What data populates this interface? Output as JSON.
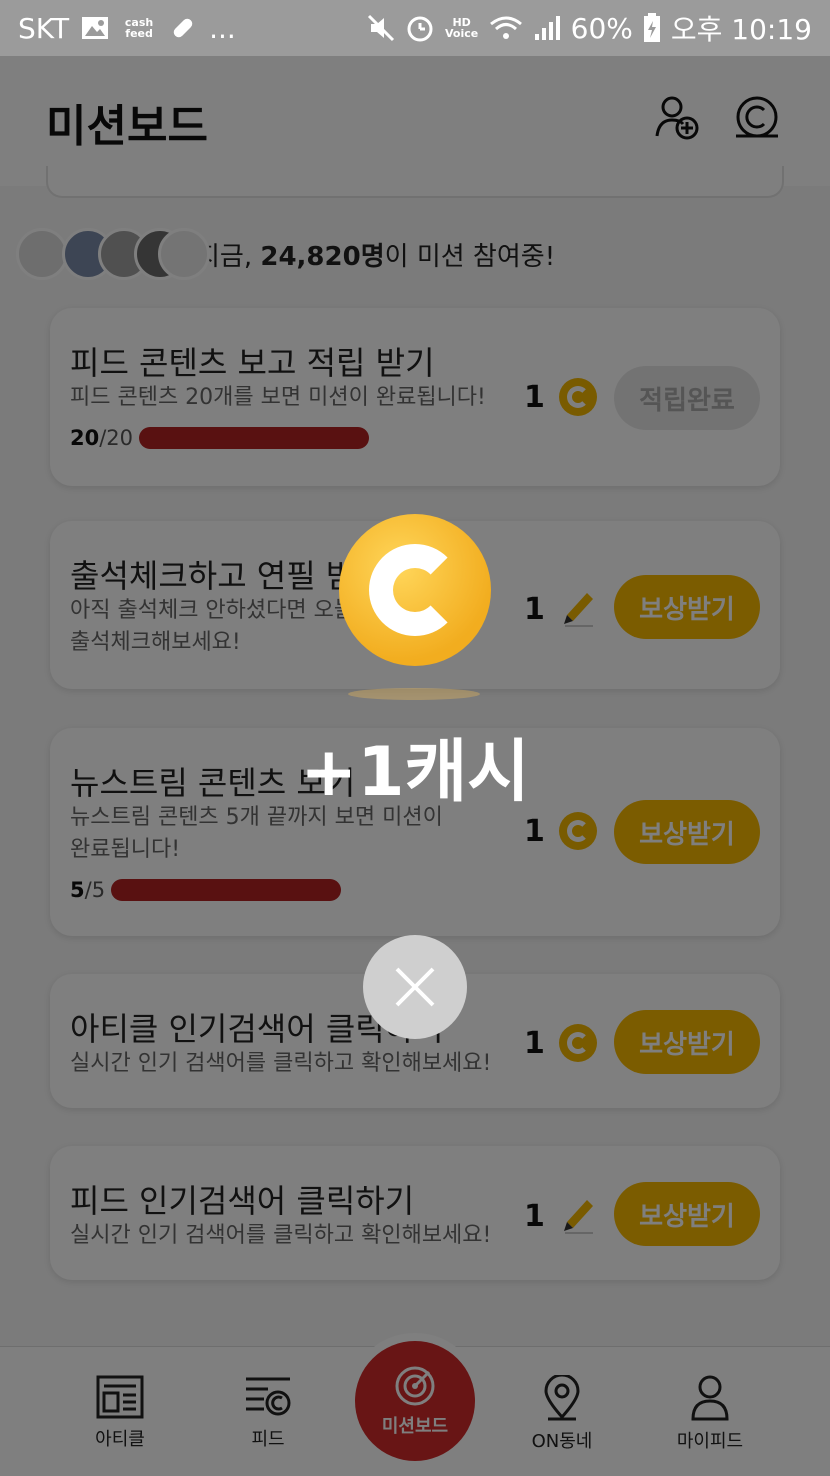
{
  "status_bar": {
    "carrier": "SKT",
    "cashfeed_label": "cash feed",
    "more": "...",
    "hd_voice": "HD Voice",
    "battery": "60%",
    "time": "오후 10:19"
  },
  "header": {
    "title": "미션보드"
  },
  "participants": {
    "prefix": "지금, ",
    "count": "24,820명",
    "suffix": "이 미션 참여중!"
  },
  "missions": [
    {
      "title": "피드 콘텐츠 보고 적립 받기",
      "desc": "피드 콘텐츠 20개를 보면 미션이 완료됩니다!",
      "progress_current": "20",
      "progress_total": "/20",
      "progress": 1.0,
      "reward": "1",
      "reward_icon": "coin-icon",
      "button": "적립완료",
      "button_state": "done"
    },
    {
      "title": "출석체크하고 연필 받기",
      "desc_line1": "아직 출석체크 안하셨다면 오늘",
      "desc_line2": "출석체크해보세요!",
      "reward": "1",
      "reward_icon": "pencil-icon",
      "button": "보상받기",
      "button_state": "claim"
    },
    {
      "title": "뉴스트림 콘텐츠 보기",
      "desc_line1": "뉴스트림 콘텐츠 5개 끝까지 보면 미션이",
      "desc_line2": "완료됩니다!",
      "progress_current": "5",
      "progress_total": "/5",
      "progress": 1.0,
      "reward": "1",
      "reward_icon": "coin-icon",
      "button": "보상받기",
      "button_state": "claim"
    },
    {
      "title": "아티클 인기검색어 클릭하기",
      "desc": "실시간 인기 검색어를 클릭하고 확인해보세요!",
      "reward": "1",
      "reward_icon": "coin-icon",
      "button": "보상받기",
      "button_state": "claim"
    },
    {
      "title": "피드 인기검색어 클릭하기",
      "desc": "실시간 인기 검색어를 클릭하고 확인해보세요!",
      "reward": "1",
      "reward_icon": "pencil-icon",
      "button": "보상받기",
      "button_state": "claim"
    }
  ],
  "bottom_nav": {
    "article": "아티클",
    "feed": "피드",
    "missionboard": "미션보드",
    "on_neighborhood": "ON동네",
    "myfeed": "마이피드"
  },
  "overlay": {
    "reward_text": "+1캐시",
    "icon": "coin-icon",
    "close_icon": "close-icon"
  },
  "colors": {
    "accent_red": "#d12a2a",
    "progress_red": "#b22222",
    "coin_yellow": "#f2b600",
    "claim_button": "#f6b800"
  }
}
